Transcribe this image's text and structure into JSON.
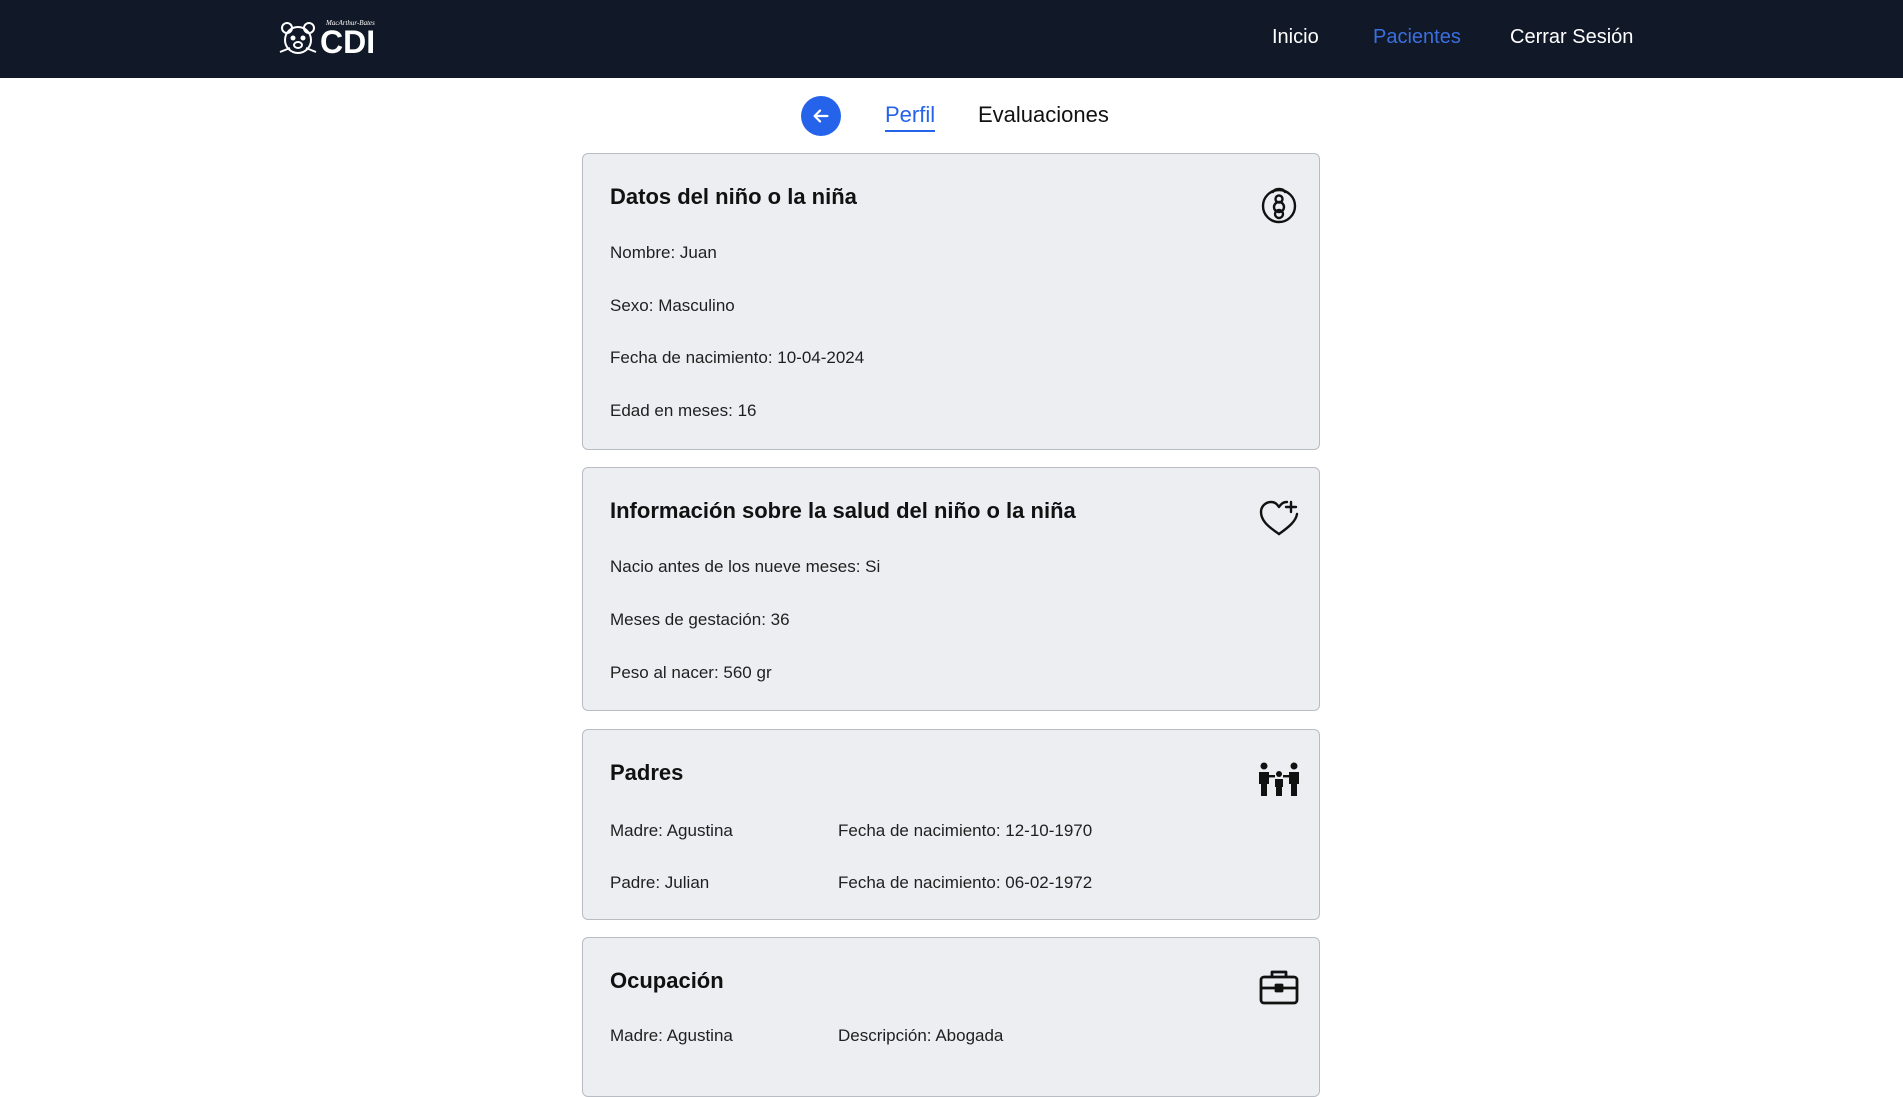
{
  "navbar": {
    "logo_text": "CDI",
    "logo_subtitle": "MacArthur-Bates",
    "links": [
      {
        "label": "Inicio"
      },
      {
        "label": "Pacientes"
      },
      {
        "label": "Cerrar Sesión"
      }
    ],
    "active_link": "Pacientes"
  },
  "tabs": {
    "items": [
      {
        "label": "Perfil"
      },
      {
        "label": "Evaluaciones"
      }
    ],
    "active": "Perfil"
  },
  "colors": {
    "navbar_bg": "#111827",
    "accent": "#2563eb",
    "card_bg": "#eceef1"
  },
  "cards": {
    "child": {
      "title": "Datos del niño o la niña",
      "icon": "baby-icon",
      "fields": [
        "Nombre: Juan",
        "Sexo: Masculino",
        "Fecha de nacimiento: 10-04-2024",
        "Edad en meses: 16"
      ]
    },
    "health": {
      "title": "Información sobre la salud del niño o la niña",
      "icon": "heart-plus-icon",
      "fields": [
        "Nacio antes de los nueve meses: Si",
        "Meses de gestación: 36",
        "Peso al nacer: 560 gr"
      ]
    },
    "parents": {
      "title": "Padres",
      "icon": "family-icon",
      "rows": [
        {
          "name": "Madre: Agustina",
          "birth": "Fecha de nacimiento: 12-10-1970"
        },
        {
          "name": "Padre: Julian",
          "birth": "Fecha de nacimiento: 06-02-1972"
        }
      ]
    },
    "occupation": {
      "title": "Ocupación",
      "icon": "briefcase-icon",
      "rows": [
        {
          "name": "Madre: Agustina",
          "desc": "Descripción: Abogada"
        }
      ]
    }
  }
}
